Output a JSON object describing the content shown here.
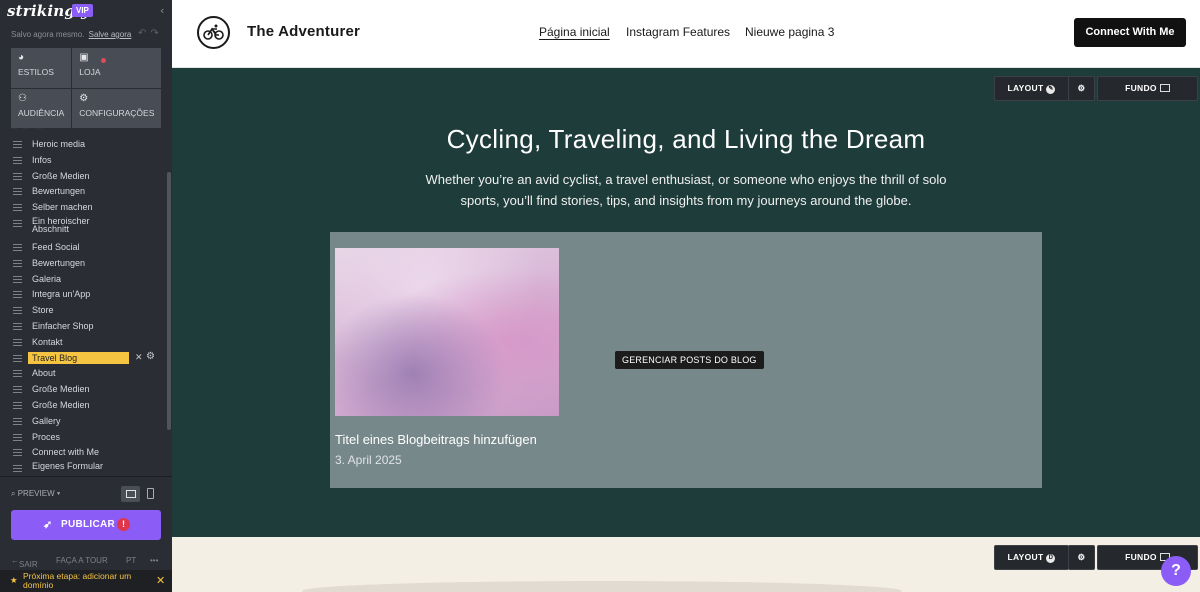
{
  "sidebar": {
    "logo": "strikingly",
    "vip_badge": "VIP",
    "saved_text": "Salvo agora mesmo.",
    "save_now_link": "Salve agora",
    "tiles": [
      {
        "label": "ESTILOS",
        "icon": "palette-icon"
      },
      {
        "label": "LOJA",
        "icon": "shopping-bag-icon"
      },
      {
        "label": "AUDIÊNCIA",
        "icon": "users-icon"
      },
      {
        "label": "CONFIGURAÇÕES",
        "icon": "gear-icon"
      }
    ],
    "sections": [
      "Heroic media",
      "Infos",
      "Große Medien",
      "Bewertungen",
      "Selber machen",
      "Ein heroischer Abschnitt",
      "Feed Social",
      "Bewertungen",
      "Galeria",
      "Integra un'App",
      "Store",
      "Einfacher Shop",
      "Kontakt",
      "Travel Blog",
      "About",
      "Große Medien",
      "Große Medien",
      "Gallery",
      "Proces",
      "Connect with Me",
      "Eigenes Formular"
    ],
    "active_section": "Travel Blog",
    "preview_label": "PREVIEW",
    "publish_label": "PUBLICAR",
    "publish_warning": "!",
    "footer": {
      "exit": "SAIR",
      "tour": "FAÇA A TOUR",
      "lang": "PT",
      "more": "•••"
    },
    "tip": "Próxima etapa: adicionar um domínio"
  },
  "topnav": {
    "site_title": "The Adventurer",
    "nav": [
      "Página inicial",
      "Instagram Features",
      "Nieuwe pagina 3"
    ],
    "cta": "Connect With Me"
  },
  "hero": {
    "title": "Cycling, Traveling, and Living the Dream",
    "subtitle": "Whether you’re an avid cyclist, a travel enthusiast, or someone who enjoys the thrill of solo sports, you’ll find stories, tips, and insights from my journeys around the globe.",
    "blog": {
      "manage_button": "GERENCIAR POSTS DO BLOG",
      "post_title": "Titel eines Blogbeitrags hinzufügen",
      "post_date": "3. April 2025"
    }
  },
  "section_controls": {
    "layout": "LAYOUT",
    "background": "FUNDO",
    "layout_badge_2": "D"
  },
  "help_button": "?",
  "colors": {
    "accent": "#8b5cf6",
    "active_section": "#f5c542",
    "hero_bg": "#1d3c3a",
    "blog_box": "#76888a"
  }
}
